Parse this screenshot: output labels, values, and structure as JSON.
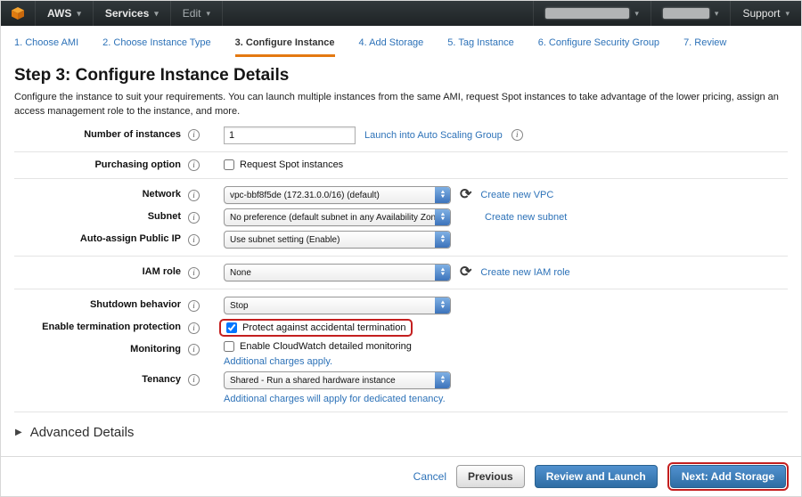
{
  "icons": {
    "caret_down": "▾",
    "info": "i",
    "refresh": "⟳",
    "arrow_up": "▲",
    "arrow_down": "▼",
    "triangle_right": "▶"
  },
  "topnav": {
    "aws_label": "AWS",
    "services_label": "Services",
    "edit_label": "Edit",
    "support_label": "Support"
  },
  "wizard": {
    "active_tab_index": 2,
    "tabs": [
      {
        "label": "1. Choose AMI"
      },
      {
        "label": "2. Choose Instance Type"
      },
      {
        "label": "3. Configure Instance"
      },
      {
        "label": "4. Add Storage"
      },
      {
        "label": "5. Tag Instance"
      },
      {
        "label": "6. Configure Security Group"
      },
      {
        "label": "7. Review"
      }
    ]
  },
  "page": {
    "title": "Step 3: Configure Instance Details",
    "description": "Configure the instance to suit your requirements. You can launch multiple instances from the same AMI, request Spot instances to take advantage of the lower pricing, assign an access management role to the instance, and more."
  },
  "form": {
    "number_of_instances": {
      "label": "Number of instances",
      "value": "1",
      "link_label": "Launch into Auto Scaling Group"
    },
    "purchasing_option": {
      "label": "Purchasing option",
      "checkbox_label": "Request Spot instances",
      "checked": false
    },
    "network": {
      "label": "Network",
      "selected": "vpc-bbf8f5de (172.31.0.0/16) (default)",
      "link_label": "Create new VPC"
    },
    "subnet": {
      "label": "Subnet",
      "selected": "No preference (default subnet in any Availability Zone)",
      "link_label": "Create new subnet"
    },
    "auto_assign_public_ip": {
      "label": "Auto-assign Public IP",
      "selected": "Use subnet setting (Enable)"
    },
    "iam_role": {
      "label": "IAM role",
      "selected": "None",
      "link_label": "Create new IAM role"
    },
    "shutdown_behavior": {
      "label": "Shutdown behavior",
      "selected": "Stop"
    },
    "termination_protection": {
      "label": "Enable termination protection",
      "checkbox_label": "Protect against accidental termination",
      "checked": true
    },
    "monitoring": {
      "label": "Monitoring",
      "checkbox_label": "Enable CloudWatch detailed monitoring",
      "checked": false,
      "note_link": "Additional charges apply."
    },
    "tenancy": {
      "label": "Tenancy",
      "selected": "Shared - Run a shared hardware instance",
      "note_link": "Additional charges will apply for dedicated tenancy."
    }
  },
  "advanced": {
    "label": "Advanced Details"
  },
  "footer": {
    "cancel_label": "Cancel",
    "previous_label": "Previous",
    "review_and_launch_label": "Review and Launch",
    "next_label": "Next: Add Storage"
  },
  "colors": {
    "accent_orange": "#e47911",
    "link_blue": "#2d72b8",
    "highlight_red": "#c41f1f",
    "button_blue": "#2e6da4",
    "nav_bg": "#24292b"
  }
}
